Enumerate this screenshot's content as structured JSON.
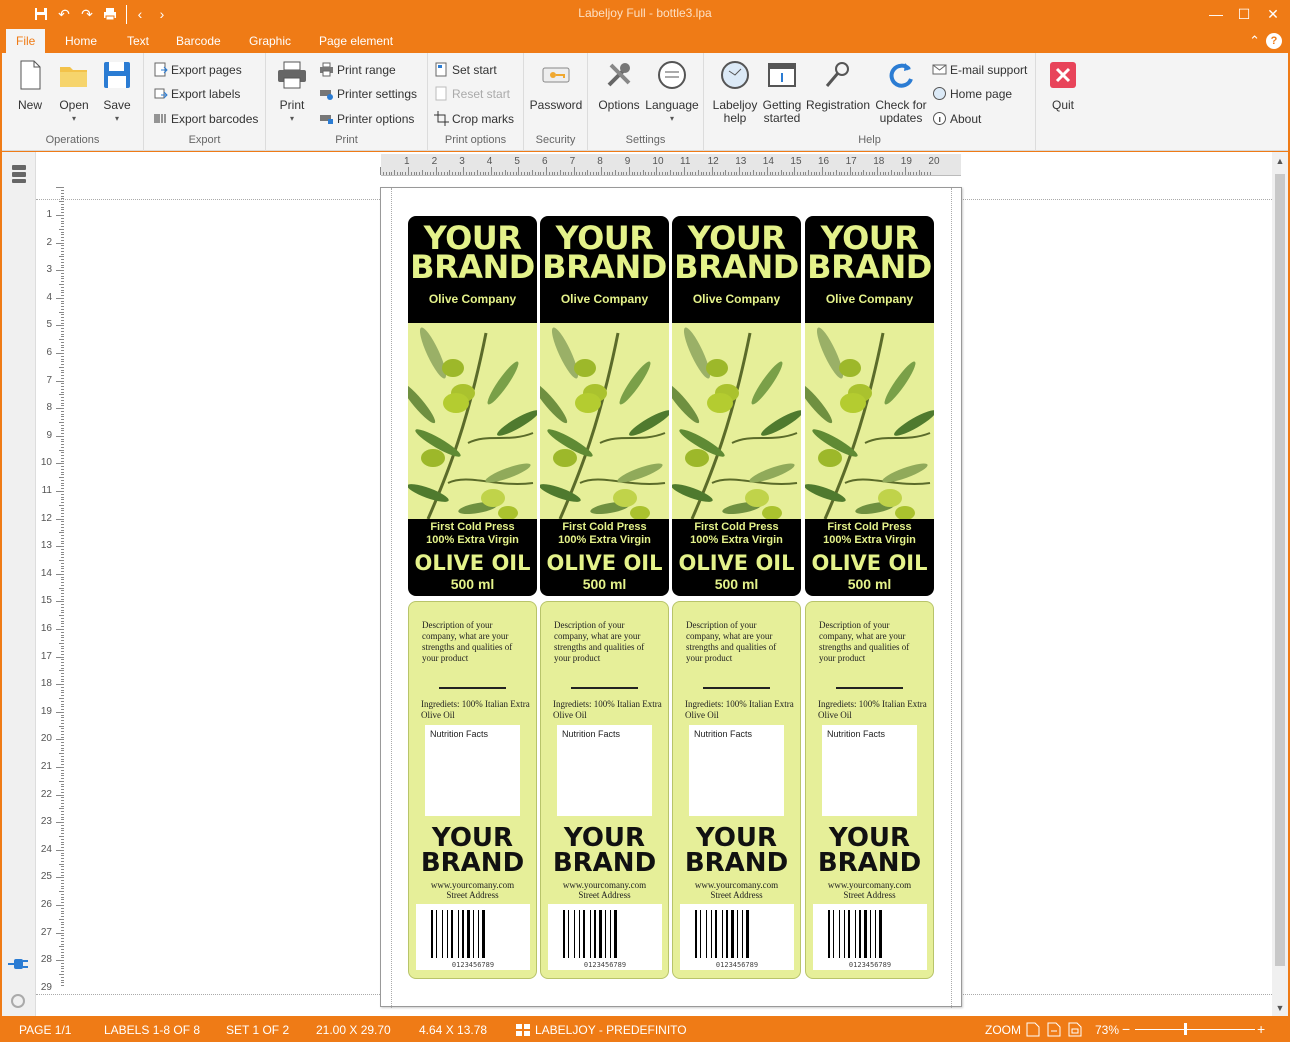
{
  "titlebar": {
    "title": "Labeljoy Full - bottle3.lpa",
    "icons": [
      "save-icon",
      "undo-icon",
      "redo-icon",
      "print-icon",
      "back-icon",
      "forward-icon"
    ]
  },
  "tabs": [
    {
      "label": "File",
      "active": true
    },
    {
      "label": "Home"
    },
    {
      "label": "Text"
    },
    {
      "label": "Barcode"
    },
    {
      "label": "Graphic"
    },
    {
      "label": "Page element"
    }
  ],
  "ribbon": {
    "operations": {
      "label": "Operations",
      "new": "New",
      "open": "Open",
      "save": "Save"
    },
    "export": {
      "label": "Export",
      "pages": "Export pages",
      "labels": "Export labels",
      "barcodes": "Export barcodes"
    },
    "print": {
      "label": "Print",
      "print": "Print",
      "range": "Print range",
      "settings": "Printer settings",
      "options": "Printer options"
    },
    "print_options": {
      "label": "Print options",
      "set_start": "Set start",
      "reset_start": "Reset start",
      "crop_marks": "Crop marks"
    },
    "security": {
      "label": "Security",
      "password": "Password"
    },
    "settings": {
      "label": "Settings",
      "options": "Options",
      "language": "Language"
    },
    "help": {
      "label": "Help",
      "labeljoy_help_1": "Labeljoy",
      "labeljoy_help_2": "help",
      "getting_started_1": "Getting",
      "getting_started_2": "started",
      "registration": "Registration",
      "check_updates_1": "Check for",
      "check_updates_2": "updates",
      "email": "E-mail support",
      "home": "Home page",
      "about": "About"
    },
    "quit": {
      "label": "Quit"
    }
  },
  "ruler": {
    "h": [
      "1",
      "2",
      "3",
      "4",
      "5",
      "6",
      "7",
      "8",
      "9",
      "10",
      "11",
      "12",
      "13",
      "14",
      "15",
      "16",
      "17",
      "18",
      "19",
      "20"
    ],
    "v": [
      "1",
      "2",
      "3",
      "4",
      "5",
      "6",
      "7",
      "8",
      "9",
      "10",
      "11",
      "12",
      "13",
      "14",
      "15",
      "16",
      "17",
      "18",
      "19",
      "20",
      "21",
      "22",
      "23",
      "24",
      "25",
      "26",
      "27",
      "28",
      "29"
    ]
  },
  "label": {
    "brand_line1": "YOUR",
    "brand_line2": "BRAND",
    "company": "Olive Company",
    "first_cold": "First Cold Press",
    "extra_virgin": "100% Extra Virgin",
    "olive_oil": "OLIVE OIL",
    "volume": "500 ml",
    "description": "Description of your company, what are your strengths and qualities of your product",
    "ingredients": "Ingrediets: 100% Italian Extra Olive Oil",
    "nutrition": "Nutrition Facts",
    "url": "www.yourcomany.com",
    "address": "Street Address",
    "barcode_number": "0123456789",
    "colors": {
      "accent": "#e4f28a",
      "panel": "#e6ef99",
      "dark": "#000000"
    }
  },
  "status": {
    "page": "PAGE 1/1",
    "labels": "LABELS 1-8 OF 8",
    "set": "SET 1 OF 2",
    "page_size": "21.00 X 29.70",
    "label_size": "4.64 X 13.78",
    "layout": "LABELJOY - PREDEFINITO",
    "zoom_label": "ZOOM",
    "zoom_value": "73%",
    "zoom_minus": "−",
    "zoom_plus": "+"
  }
}
